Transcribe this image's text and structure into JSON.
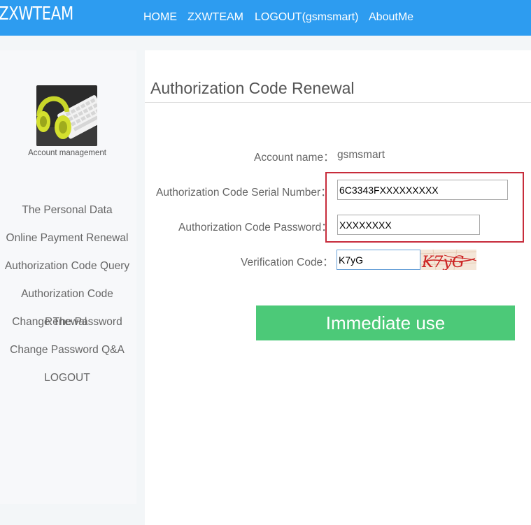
{
  "header": {
    "logo": "ZXWTEAM",
    "nav": {
      "home": "HOME",
      "zxwteam": "ZXWTEAM",
      "logout": "LOGOUT(gsmsmart)",
      "about": "AboutMe"
    }
  },
  "sidebar": {
    "account_label": "Account management",
    "items": [
      "The Personal Data",
      "Online Payment Renewal",
      "Authorization Code Query",
      "Authorization Code",
      "Change The Password",
      "Change Password Q&A",
      "LOGOUT"
    ],
    "overlay_text": "Renewal"
  },
  "main": {
    "title": "Authorization Code Renewal",
    "form": {
      "account_name_label": "Account name：",
      "account_name_value": "gsmsmart",
      "serial_label": "Authorization Code Serial Number：",
      "serial_value": "6C3343FXXXXXXXXX",
      "password_label": "Authorization Code Password：",
      "password_value": "XXXXXXXX",
      "verify_label": "Verification Code：",
      "verify_value": "K7yG",
      "captcha_text": "K7yG"
    },
    "submit_label": "Immediate use"
  },
  "colors": {
    "header": "#2d9cf0",
    "button": "#4cc978",
    "highlight": "#c72c3b",
    "captcha_text": "#cc2222"
  }
}
